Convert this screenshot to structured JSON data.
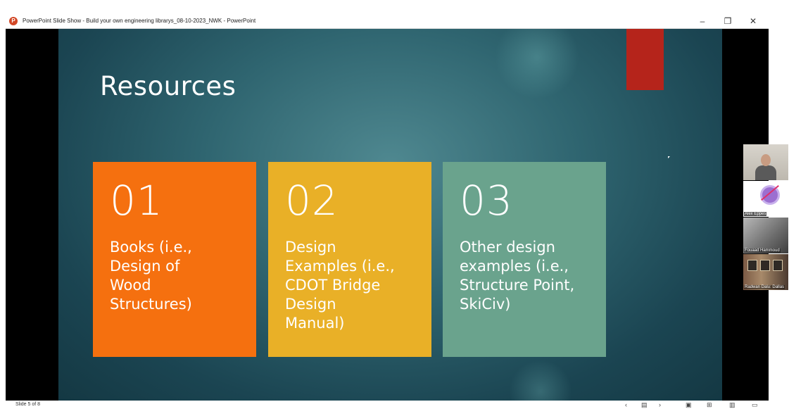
{
  "window": {
    "title": "PowerPoint Slide Show  -  Build your own engineering librarys_08-10-2023_NWK - PowerPoint",
    "app_icon": "powerpoint-icon",
    "controls": {
      "minimize": "–",
      "restore": "❐",
      "close": "✕"
    }
  },
  "slide": {
    "title": "Resources",
    "cards": [
      {
        "number": "01",
        "text": "Books (i.e.,\nDesign of\nWood\nStructures)",
        "color": "#f5700f"
      },
      {
        "number": "02",
        "text": "Design\nExamples (i.e.,\nCDOT Bridge\nDesign\nManual)",
        "color": "#e9b027"
      },
      {
        "number": "03",
        "text": "Other design\nexamples (i.e.,\nStructure Point,\nSkiCiv)",
        "color": "#6aa38d"
      }
    ],
    "accent_color": "#b5241b"
  },
  "statusbar": {
    "slide_count": "Slide 5 of 8",
    "prev": "‹",
    "slides_view": "▤",
    "next": "›",
    "view_buttons": [
      "▣",
      "⊞",
      "▥",
      "▭"
    ]
  },
  "participants": [
    {
      "name": "",
      "kind": "video"
    },
    {
      "name": "Alex Eppes",
      "kind": "avatar"
    },
    {
      "name": "Fouaad Hammoud",
      "kind": "video"
    },
    {
      "name": "Radwan Dalu: Dallas",
      "kind": "video"
    }
  ]
}
